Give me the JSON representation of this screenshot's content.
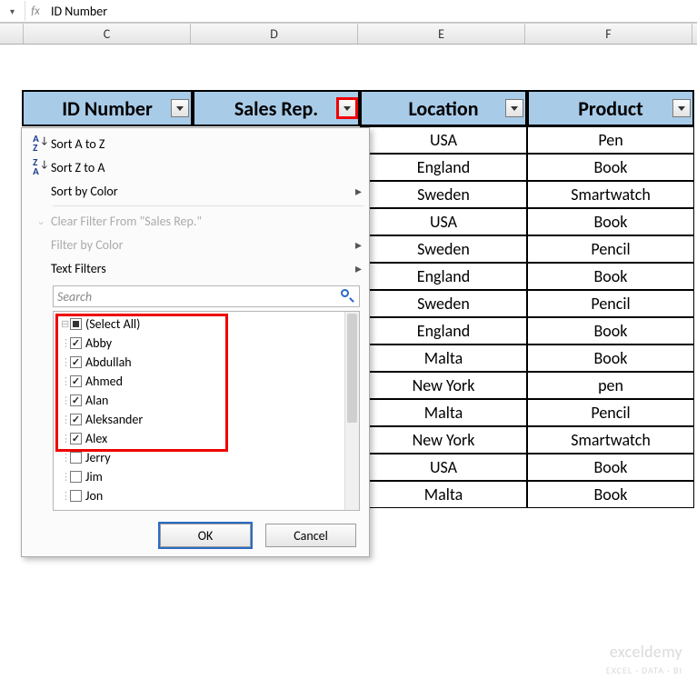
{
  "formula_bar": {
    "fx": "fx",
    "value": "ID Number"
  },
  "columns": {
    "C": "C",
    "D": "D",
    "E": "E",
    "F": "F"
  },
  "headers": {
    "id_number": "ID Number",
    "sales_rep": "Sales Rep.",
    "location": "Location",
    "product": "Product"
  },
  "rows": [
    {
      "location": "USA",
      "product": "Pen"
    },
    {
      "location": "England",
      "product": "Book"
    },
    {
      "location": "Sweden",
      "product": "Smartwatch"
    },
    {
      "location": "USA",
      "product": "Book"
    },
    {
      "location": "Sweden",
      "product": "Pencil"
    },
    {
      "location": "England",
      "product": "Book"
    },
    {
      "location": "Sweden",
      "product": "Pencil"
    },
    {
      "location": "England",
      "product": "Book"
    },
    {
      "location": "Malta",
      "product": "Book"
    },
    {
      "location": "New York",
      "product": "pen"
    },
    {
      "location": "Malta",
      "product": "Pencil"
    },
    {
      "location": "New York",
      "product": "Smartwatch"
    },
    {
      "location": "USA",
      "product": "Book"
    },
    {
      "location": "Malta",
      "product": "Book"
    }
  ],
  "menu": {
    "sort_az": "Sort A to Z",
    "sort_za": "Sort Z to A",
    "sort_color": "Sort by Color",
    "clear_filter": "Clear Filter From \"Sales Rep.\"",
    "filter_color": "Filter by Color",
    "text_filters": "Text Filters",
    "search_placeholder": "Search",
    "items": [
      {
        "label": "(Select All)",
        "state": "mixed"
      },
      {
        "label": "Abby",
        "state": "checked"
      },
      {
        "label": "Abdullah",
        "state": "checked"
      },
      {
        "label": "Ahmed",
        "state": "checked"
      },
      {
        "label": "Alan",
        "state": "checked"
      },
      {
        "label": "Aleksander",
        "state": "checked"
      },
      {
        "label": "Alex",
        "state": "checked"
      },
      {
        "label": "Jerry",
        "state": "unchecked"
      },
      {
        "label": "Jim",
        "state": "unchecked"
      },
      {
        "label": "Jon",
        "state": "unchecked"
      }
    ],
    "ok": "OK",
    "cancel": "Cancel"
  },
  "watermark": {
    "brand": "exceldemy",
    "tag": "EXCEL · DATA · BI"
  }
}
